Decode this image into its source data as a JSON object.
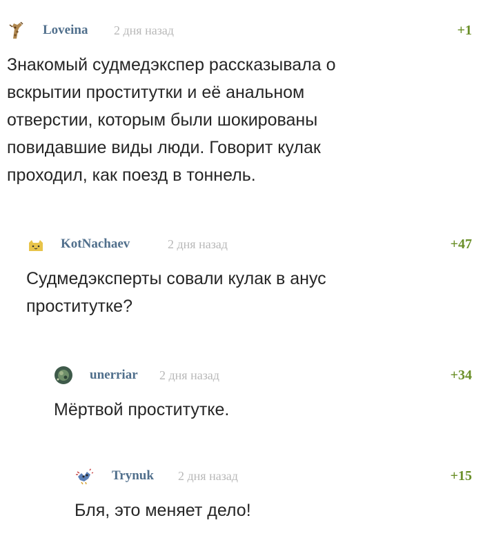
{
  "comments": [
    {
      "username": "Loveina",
      "time": "2 дня назад",
      "rating": "+1",
      "avatar_icon": "giraffe-icon",
      "text": "Знакомый судмедэкспер рассказывала о\nвскрытии проститутки и её анальном\nотверстии, которым были шокированы\nповидавшие виды люди. Говорит кулак\nпроходил, как поезд в тоннель."
    },
    {
      "username": "KotNachaev",
      "time": "2 дня назад",
      "rating": "+47",
      "avatar_icon": "cat-icon",
      "text": "Судмедэксперты совали кулак в анус\nпроститутке?"
    },
    {
      "username": "unerriar",
      "time": "2 дня назад",
      "rating": "+34",
      "avatar_icon": "planet-icon",
      "text": "Мёртвой проститутке."
    },
    {
      "username": "Trynuk",
      "time": "2 дня назад",
      "rating": "+15",
      "avatar_icon": "sparkle-creature-icon",
      "text": "Бля, это меняет дело!"
    }
  ],
  "colors": {
    "username": "#506f8c",
    "time": "#b8b8b8",
    "rating": "#6a8f28",
    "text": "#262626"
  }
}
